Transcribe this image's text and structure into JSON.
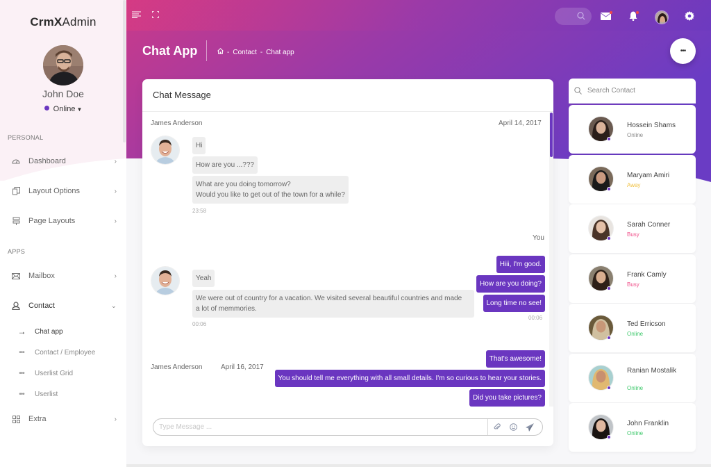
{
  "app": {
    "brand_bold": "CrmX",
    "brand_light": "Admin"
  },
  "colors": {
    "accent": "#6a36c0",
    "header_start": "#e8407a",
    "header_end": "#6a3cc4",
    "online": "#3cc86a",
    "away": "#f0c040",
    "busy": "#f0508a"
  },
  "profile": {
    "name": "John Doe",
    "status": "Online"
  },
  "sidebar": {
    "sections": [
      "PERSONAL",
      "APPS"
    ],
    "items": [
      {
        "label": "Dashboard",
        "icon": "dashboard-gauge-icon"
      },
      {
        "label": "Layout Options",
        "icon": "copy-icon"
      },
      {
        "label": "Page Layouts",
        "icon": "layout-icon"
      },
      {
        "label": "Mailbox",
        "icon": "mail-icon"
      },
      {
        "label": "Contact",
        "icon": "user-icon"
      },
      {
        "label": "Extra",
        "icon": "grid-icon"
      }
    ],
    "subitems": [
      {
        "label": "Chat app",
        "active": true
      },
      {
        "label": "Contact / Employee"
      },
      {
        "label": "Userlist Grid"
      },
      {
        "label": "Userlist"
      }
    ]
  },
  "page": {
    "title": "Chat App",
    "breadcrumb": [
      "Contact",
      "Chat app"
    ],
    "more_label": "•••"
  },
  "chat": {
    "title": "Chat Message",
    "threads": [
      {
        "sender": "James Anderson",
        "date": "April 14, 2017",
        "incoming": [
          "Hi",
          "How are you ...???",
          "What are you doing tomorrow?\nWould you like to get out of the town for a while?"
        ],
        "incoming_time": "23:58",
        "out_label": "You",
        "incoming2": [
          "Yeah",
          "We were out of country for a vacation. We visited several beautiful countries and made\na lot of memmories."
        ],
        "incoming2_time": "00:06",
        "outgoing": [
          "Hiii, I'm good.",
          "How are you doing?",
          "Long time no see!"
        ],
        "outgoing_time": "00:06"
      },
      {
        "sender": "James Anderson",
        "date": "April 16, 2017",
        "outgoing": [
          "That's awesome!",
          "You should tell me everything with all small details. I'm so curious to hear your stories.",
          "Did you take pictures?"
        ]
      }
    ],
    "input_placeholder": "Type Message ..."
  },
  "contacts": {
    "search_placeholder": "Search Contact",
    "list": [
      {
        "name": "Hossein Shams",
        "status": "Online",
        "status_color": "#888888"
      },
      {
        "name": "Maryam Amiri",
        "status": "Away",
        "status_color": "#f0c040"
      },
      {
        "name": "Sarah Conner",
        "status": "Busy",
        "status_color": "#f0508a"
      },
      {
        "name": "Frank Camly",
        "status": "Busy",
        "status_color": "#f0508a"
      },
      {
        "name": "Ted Erricson",
        "status": "Online",
        "status_color": "#3cc86a"
      },
      {
        "name": "Ranian Mostalik",
        "status": "Online",
        "status_color": "#3cc86a"
      },
      {
        "name": "John Franklin",
        "status": "Online",
        "status_color": "#3cc86a"
      }
    ]
  }
}
